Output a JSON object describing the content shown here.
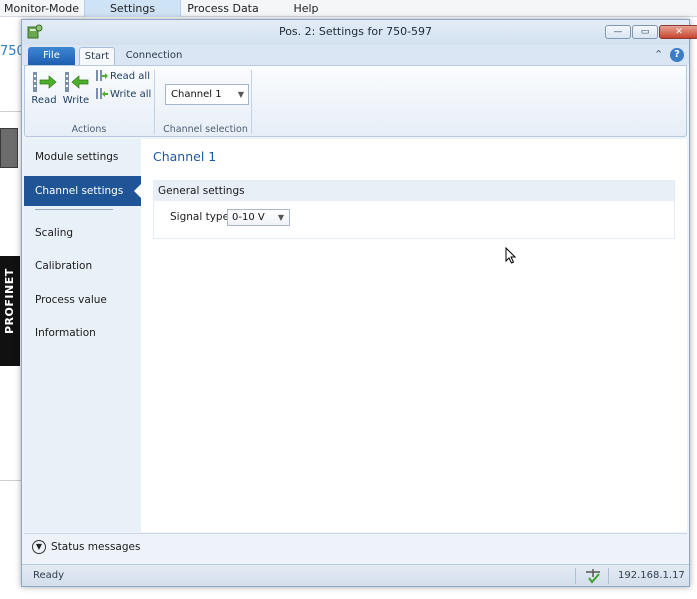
{
  "background_app": {
    "menu": [
      {
        "label": "Monitor-Mode",
        "active": false
      },
      {
        "label": "Settings",
        "active": true
      },
      {
        "label": "Process Data",
        "active": false
      },
      {
        "label": "Help",
        "active": false
      }
    ],
    "code_fragment": "750-",
    "side_label": "PROFINET"
  },
  "dialog": {
    "title": "Pos. 2: Settings for 750-597",
    "window_buttons": {
      "minimize": "—",
      "maximize": "▭",
      "close": "✕"
    },
    "tabs": {
      "file": "File",
      "start": "Start",
      "connection": "Connection"
    },
    "ribbon": {
      "read_label": "Read",
      "write_label": "Write",
      "read_all_label": "Read all",
      "write_all_label": "Write all",
      "actions_group": "Actions",
      "channel_combo_value": "Channel 1",
      "channel_group": "Channel selection"
    },
    "nav": {
      "items": [
        "Module settings",
        "Channel settings",
        "Scaling",
        "Calibration",
        "Process value",
        "Information"
      ],
      "selected": "Channel settings"
    },
    "content": {
      "title": "Channel 1",
      "section_header": "General settings",
      "signal_type_label": "Signal type",
      "signal_type_value": "0-10 V"
    },
    "status_messages_label": "Status messages",
    "statusbar": {
      "ready": "Ready",
      "ip": "192.168.1.17"
    }
  },
  "colors": {
    "accent": "#1f5596",
    "title_blue": "#1f5aa0",
    "file_tab": "#2a6fc2",
    "close_button": "#c5452f"
  }
}
